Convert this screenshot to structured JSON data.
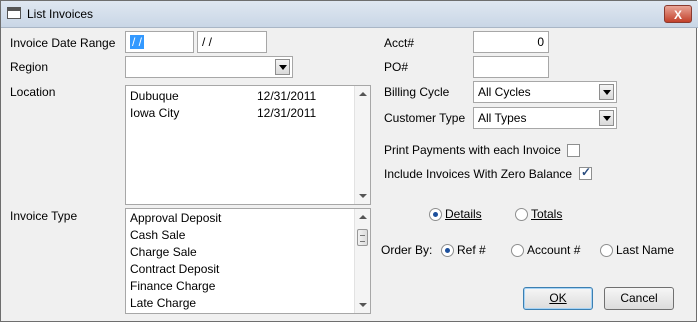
{
  "window": {
    "title": "List Invoices",
    "close_glyph": "X"
  },
  "invoice_date_range": {
    "label": "Invoice Date Range",
    "from": "/ /",
    "to": "/ /"
  },
  "region": {
    "label": "Region",
    "value": ""
  },
  "location": {
    "label": "Location",
    "items": [
      {
        "name": "Dubuque",
        "date": "12/31/2011"
      },
      {
        "name": "Iowa City",
        "date": "12/31/2011"
      }
    ]
  },
  "invoice_type": {
    "label": "Invoice Type",
    "items": [
      "Approval Deposit",
      "Cash Sale",
      "Charge Sale",
      "Contract Deposit",
      "Finance Charge",
      "Late Charge"
    ]
  },
  "acct": {
    "label": "Acct#",
    "value": "0"
  },
  "po": {
    "label": "PO#",
    "value": ""
  },
  "billing_cycle": {
    "label": "Billing Cycle",
    "value": "All Cycles"
  },
  "customer_type": {
    "label": "Customer Type",
    "value": "All Types"
  },
  "print_payments": {
    "label": "Print Payments with each Invoice",
    "checked": false
  },
  "include_zero": {
    "label": "Include Invoices With Zero Balance",
    "checked": true
  },
  "detail_mode": {
    "details_label": "Details",
    "totals_label": "Totals",
    "selected": "details"
  },
  "order_by": {
    "label": "Order By:",
    "options": [
      "Ref #",
      "Account #",
      "Last Name"
    ],
    "selected": "Ref #"
  },
  "buttons": {
    "ok": "OK",
    "cancel": "Cancel"
  }
}
